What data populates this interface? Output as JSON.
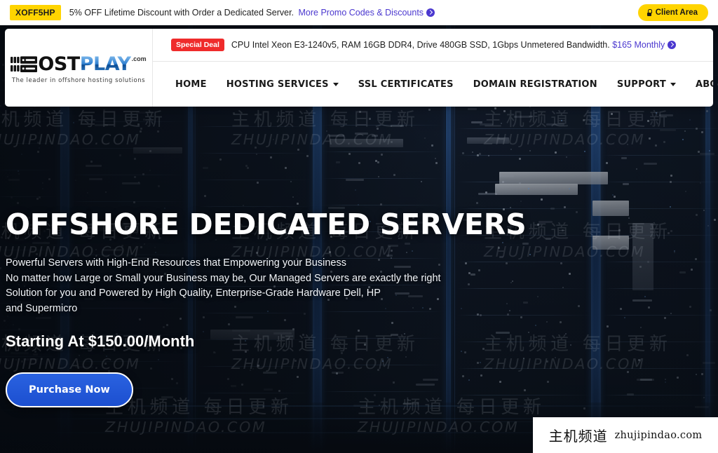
{
  "topbar": {
    "promo_code": "XOFF5HP",
    "promo_text": "5% OFF Lifetime Discount with Order a Dedicated Server.",
    "promo_link": "More Promo Codes & Discounts",
    "arrow_icon": "circle-arrow-right-icon",
    "client_area_label": "Client Area",
    "lock_icon": "lock-icon",
    "badge_color": "#ffd400",
    "link_color": "#4b38cf"
  },
  "logo": {
    "name_dark": "OST",
    "name_blue": "PLAY",
    "dotcom": ".com",
    "tagline": "The leader in offshore hosting solutions",
    "rack_icon": "server-rack-icon"
  },
  "deal": {
    "badge": "Special Deal",
    "badge_color": "#ef2b2b",
    "text": "CPU Intel Xeon E3-1240v5, RAM 16GB DDR4, Drive 480GB SSD, 1Gbps Unmetered Bandwidth.",
    "price_link": "$165 Monthly",
    "arrow_icon": "circle-arrow-right-icon"
  },
  "nav": {
    "items": [
      {
        "label": "HOME",
        "caret": false
      },
      {
        "label": "HOSTING SERVICES",
        "caret": true
      },
      {
        "label": "SSL CERTIFICATES",
        "caret": false
      },
      {
        "label": "DOMAIN REGISTRATION",
        "caret": false
      },
      {
        "label": "SUPPORT",
        "caret": true
      },
      {
        "label": "ABOUT US",
        "caret": true
      }
    ]
  },
  "hero": {
    "heading": "OFFSHORE DEDICATED SERVERS",
    "lead_lines": [
      "Powerful Servers with High-End Resources that Empowering your Business",
      "No matter how Large or Small your Business may be, Our Managed Servers are exactly the right",
      "Solution for you and Powered by High Quality, Enterprise-Grade Hardware Dell, HP",
      "and Supermicro"
    ],
    "price": "Starting At $150.00/Month",
    "cta_label": "Purchase Now",
    "cta_color": "#1c4fd0",
    "background": "datacenter-server-racks"
  },
  "watermarks": {
    "cn": "主机频道 每日更新",
    "en": "ZHUJIPINDAO.COM"
  },
  "watermark_badge": {
    "cn": "主机频道",
    "en": "zhujipindao.com"
  }
}
